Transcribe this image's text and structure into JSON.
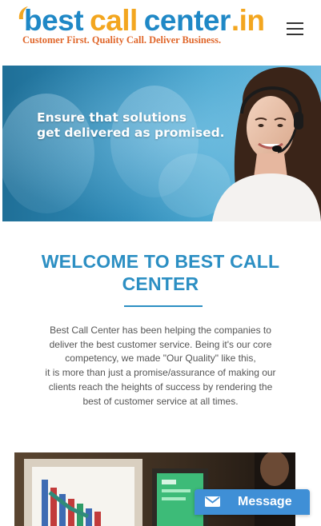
{
  "header": {
    "logo": {
      "part1": "best",
      "part2": "call",
      "part3": "center",
      "part4": ".in",
      "tagline": "Customer First. Quality Call. Deliver Business."
    },
    "menu_icon": "hamburger-menu-icon"
  },
  "hero": {
    "line1": "Ensure that solutions",
    "line2": "get delivered as promised."
  },
  "welcome": {
    "title_line1": "WELCOME TO BEST CALL",
    "title_line2": "CENTER",
    "body_lines": [
      "Best Call Center has been helping the companies to",
      "deliver the best customer service. Being it's our core",
      "competency, we made \"Our Quality\" like this,",
      "it is more than just a promise/assurance of making our",
      "clients reach the heights of success by rendering the",
      "best of customer service at all times."
    ]
  },
  "message_button": {
    "label": "Message",
    "icon": "envelope-icon"
  },
  "colors": {
    "brand_blue": "#1f88c6",
    "brand_orange": "#f3a61f",
    "tagline_orange": "#e0672b",
    "heading_blue": "#2c8fc3",
    "message_button": "#3f8fd6"
  }
}
